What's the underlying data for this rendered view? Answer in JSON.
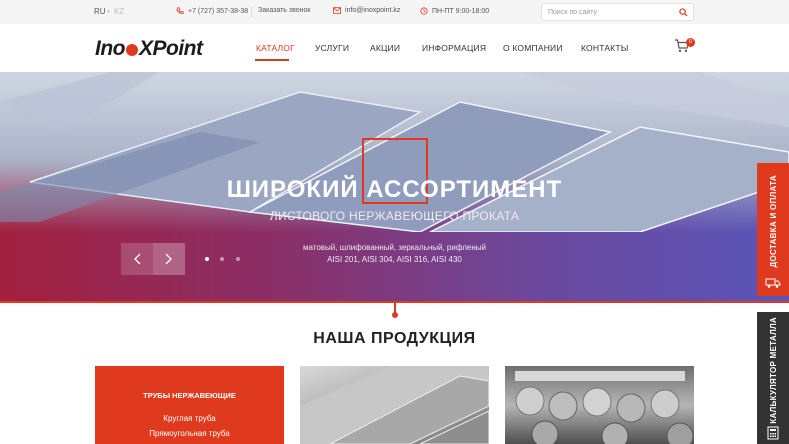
{
  "topbar": {
    "lang_ru": "RU",
    "lang_kz": "KZ",
    "lang_sep": "•",
    "phone": "+7 (727) 357-38-38",
    "callback": "Заказать звонок",
    "email": "info@inoxpoint.kz",
    "hours": "ПН-ПТ  9:00-18:00",
    "search_placeholder": "Поиск по сайту"
  },
  "header": {
    "logo_left": "Ino",
    "logo_right": "XPoint",
    "nav": [
      "КАТАЛОГ",
      "УСЛУГИ",
      "АКЦИИ",
      "ИНФОРМАЦИЯ",
      "О КОМПАНИИ",
      "КОНТАКТЫ"
    ],
    "cart_count": "0"
  },
  "hero": {
    "title": "ШИРОКИЙ АССОРТИМЕНТ",
    "subtitle": "ЛИСТОВОГО НЕРЖАВЕЮЩЕГО ПРОКАТА",
    "line1": "матовый, шлифованный, зеркальный, рифленый",
    "line2": "AISI 201, AISI 304, AISI 316, AISI 430",
    "slide_count": 3,
    "active_slide": 1
  },
  "side_tabs": {
    "delivery": "ДОСТАВКА И ОПЛАТА",
    "calculator": "КАЛЬКУЛЯТОР МЕТАЛЛА"
  },
  "products": {
    "section_title": "НАША ПРОДУКЦИЯ",
    "first_card": {
      "title": "ТРУБЫ НЕРЖАВЕЮЩИЕ",
      "links": [
        "Круглая труба",
        "Прямоугольная труба"
      ]
    }
  },
  "colors": {
    "accent": "#e03a1e",
    "dark": "#333333"
  },
  "icons": {
    "phone": "phone-icon",
    "mail": "mail-icon",
    "clock": "clock-icon",
    "search": "search-icon",
    "cart": "cart-icon"
  }
}
